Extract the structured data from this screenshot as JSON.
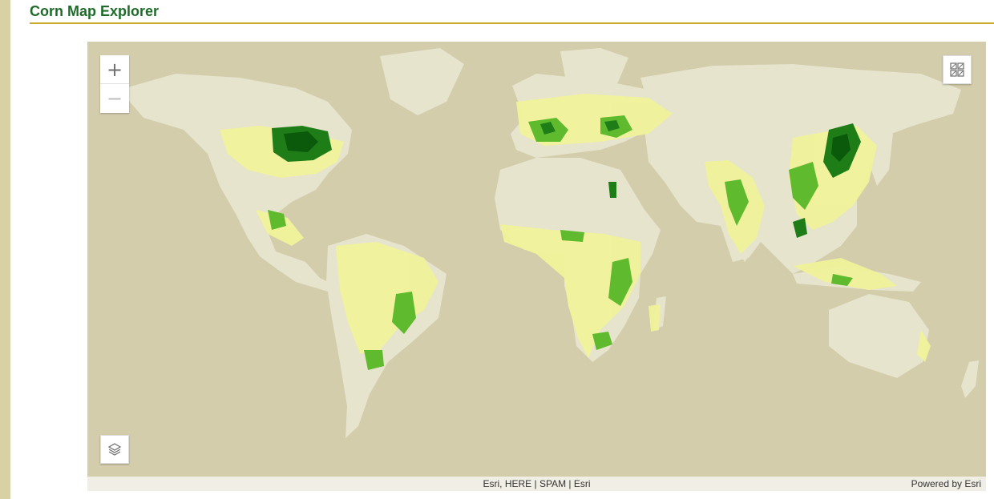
{
  "page": {
    "title": "Corn Map Explorer"
  },
  "colors": {
    "title_green": "#1f6b2a",
    "rule_gold": "#c9a92a",
    "ocean": "#d4cdac",
    "land": "#e6e4cd",
    "corn_low": "#f0f29a",
    "corn_mid": "#5fba2e",
    "corn_high": "#1e7d17",
    "corn_very_high": "#0b5a0b"
  },
  "map": {
    "controls": {
      "zoom_in_icon": "plus-icon",
      "zoom_out_icon": "minus-icon",
      "basemap_gallery_icon": "grid-icon",
      "layers_icon": "layers-icon"
    },
    "attribution": "Esri, HERE | SPAM | Esri",
    "powered_by": "Powered by Esri"
  }
}
